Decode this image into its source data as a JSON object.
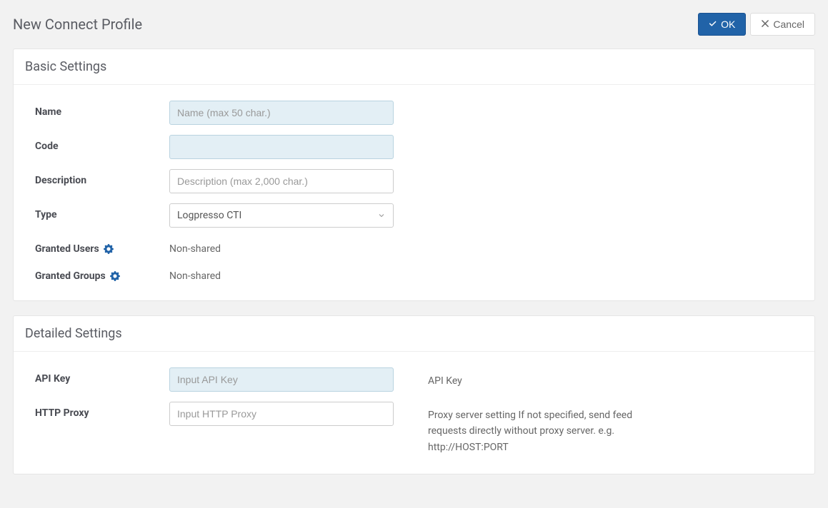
{
  "pageTitle": "New Connect Profile",
  "buttons": {
    "ok": "OK",
    "cancel": "Cancel"
  },
  "basicSettings": {
    "title": "Basic Settings",
    "nameLabel": "Name",
    "namePlaceholder": "Name (max 50 char.)",
    "codeLabel": "Code",
    "descriptionLabel": "Description",
    "descriptionPlaceholder": "Description (max 2,000 char.)",
    "typeLabel": "Type",
    "typeValue": "Logpresso CTI",
    "grantedUsersLabel": "Granted Users",
    "grantedUsersValue": "Non-shared",
    "grantedGroupsLabel": "Granted Groups",
    "grantedGroupsValue": "Non-shared"
  },
  "detailedSettings": {
    "title": "Detailed Settings",
    "apiKeyLabel": "API Key",
    "apiKeyPlaceholder": "Input API Key",
    "apiKeyHelp": "API Key",
    "httpProxyLabel": "HTTP Proxy",
    "httpProxyPlaceholder": "Input HTTP Proxy",
    "httpProxyHelp": "Proxy server setting If not specified, send feed requests directly without proxy server. e.g. http://HOST:PORT"
  }
}
